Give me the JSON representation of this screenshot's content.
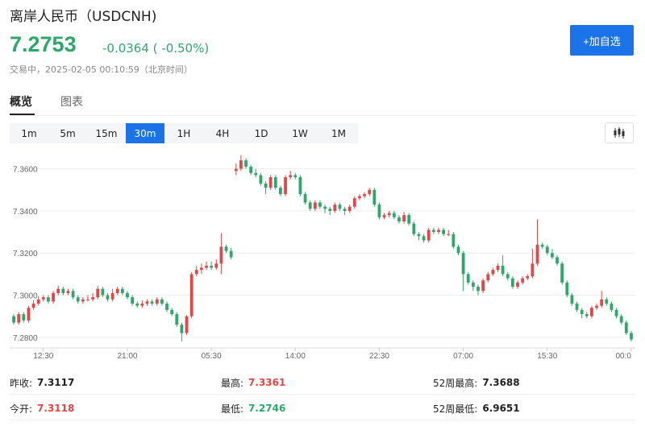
{
  "header": {
    "title": "离岸人民币（USDCNH)",
    "price": "7.2753",
    "change": "-0.0364 ( -0.50%)",
    "status": "交易中，2025-02-05 00:10:59（北京时间）",
    "add_button": "+加自选"
  },
  "tabs": [
    {
      "label": "概览",
      "active": true
    },
    {
      "label": "图表",
      "active": false
    }
  ],
  "intervals": [
    {
      "label": "1m",
      "active": false
    },
    {
      "label": "5m",
      "active": false
    },
    {
      "label": "15m",
      "active": false
    },
    {
      "label": "30m",
      "active": true
    },
    {
      "label": "1H",
      "active": false
    },
    {
      "label": "4H",
      "active": false
    },
    {
      "label": "1D",
      "active": false
    },
    {
      "label": "1W",
      "active": false
    },
    {
      "label": "1M",
      "active": false
    }
  ],
  "chart_type_icon": "candlestick-icon",
  "colors": {
    "up": "#e64545",
    "down": "#2ca86a",
    "accent": "#1a73e8"
  },
  "chart_data": {
    "type": "candlestick",
    "y_ticks": [
      "7.3600",
      "7.3400",
      "7.3200",
      "7.3000",
      "7.2800"
    ],
    "ylim": [
      7.2765,
      7.3675
    ],
    "x_ticks": [
      "12:30",
      "21:00",
      "05:30",
      "14:00",
      "22:30",
      "07:00",
      "15:30",
      "00:0"
    ],
    "x_tick_index": [
      6,
      23,
      40,
      57,
      74,
      91,
      108,
      125
    ],
    "candles": [
      [
        7.29,
        7.287,
        7.291,
        7.286
      ],
      [
        7.287,
        7.291,
        7.292,
        7.286
      ],
      [
        7.291,
        7.288,
        7.292,
        7.287
      ],
      [
        7.288,
        7.294,
        7.295,
        7.287
      ],
      [
        7.294,
        7.296,
        7.2975,
        7.293
      ],
      [
        7.296,
        7.298,
        7.2995,
        7.295
      ],
      [
        7.298,
        7.299,
        7.3,
        7.297
      ],
      [
        7.299,
        7.297,
        7.3,
        7.296
      ],
      [
        7.297,
        7.301,
        7.302,
        7.296
      ],
      [
        7.301,
        7.303,
        7.3045,
        7.3
      ],
      [
        7.303,
        7.301,
        7.304,
        7.3
      ],
      [
        7.301,
        7.302,
        7.303,
        7.3
      ],
      [
        7.302,
        7.299,
        7.303,
        7.298
      ],
      [
        7.299,
        7.297,
        7.3,
        7.296
      ],
      [
        7.297,
        7.298,
        7.299,
        7.296
      ],
      [
        7.298,
        7.298,
        7.3,
        7.297
      ],
      [
        7.298,
        7.299,
        7.301,
        7.297
      ],
      [
        7.299,
        7.303,
        7.3045,
        7.298
      ],
      [
        7.303,
        7.3,
        7.304,
        7.299
      ],
      [
        7.3,
        7.298,
        7.301,
        7.297
      ],
      [
        7.298,
        7.301,
        7.303,
        7.297
      ],
      [
        7.301,
        7.303,
        7.304,
        7.3
      ],
      [
        7.303,
        7.301,
        7.304,
        7.3
      ],
      [
        7.301,
        7.299,
        7.302,
        7.298
      ],
      [
        7.299,
        7.296,
        7.3,
        7.295
      ],
      [
        7.296,
        7.295,
        7.297,
        7.294
      ],
      [
        7.295,
        7.296,
        7.2975,
        7.294
      ],
      [
        7.296,
        7.297,
        7.298,
        7.295
      ],
      [
        7.297,
        7.296,
        7.298,
        7.295
      ],
      [
        7.296,
        7.298,
        7.299,
        7.295
      ],
      [
        7.298,
        7.296,
        7.299,
        7.295
      ],
      [
        7.296,
        7.293,
        7.297,
        7.292
      ],
      [
        7.293,
        7.291,
        7.294,
        7.29
      ],
      [
        7.291,
        7.286,
        7.292,
        7.285
      ],
      [
        7.286,
        7.282,
        7.287,
        7.278
      ],
      [
        7.282,
        7.29,
        7.2905,
        7.281
      ],
      [
        7.29,
        7.31,
        7.311,
        7.289
      ],
      [
        7.31,
        7.312,
        7.314,
        7.309
      ],
      [
        7.312,
        7.313,
        7.315,
        7.31
      ],
      [
        7.313,
        7.314,
        7.316,
        7.312
      ],
      [
        7.314,
        7.313,
        7.316,
        7.312
      ],
      [
        7.313,
        7.315,
        7.317,
        7.312
      ],
      [
        7.315,
        7.323,
        7.3295,
        7.31
      ],
      [
        7.323,
        7.321,
        7.324,
        7.32
      ],
      [
        7.321,
        7.318,
        7.3225,
        7.317
      ],
      [
        7.359,
        7.36,
        7.3625,
        7.357
      ],
      [
        7.36,
        7.364,
        7.3665,
        7.359
      ],
      [
        7.364,
        7.361,
        7.365,
        7.36
      ],
      [
        7.361,
        7.358,
        7.362,
        7.357
      ],
      [
        7.358,
        7.357,
        7.36,
        7.356
      ],
      [
        7.357,
        7.353,
        7.358,
        7.352
      ],
      [
        7.353,
        7.351,
        7.354,
        7.348
      ],
      [
        7.351,
        7.356,
        7.357,
        7.35
      ],
      [
        7.356,
        7.351,
        7.357,
        7.35
      ],
      [
        7.351,
        7.348,
        7.352,
        7.347
      ],
      [
        7.348,
        7.356,
        7.357,
        7.347
      ],
      [
        7.356,
        7.357,
        7.359,
        7.355
      ],
      [
        7.357,
        7.356,
        7.358,
        7.355
      ],
      [
        7.356,
        7.348,
        7.357,
        7.347
      ],
      [
        7.348,
        7.344,
        7.349,
        7.343
      ],
      [
        7.344,
        7.341,
        7.345,
        7.34
      ],
      [
        7.341,
        7.344,
        7.345,
        7.34
      ],
      [
        7.344,
        7.342,
        7.345,
        7.341
      ],
      [
        7.342,
        7.341,
        7.343,
        7.339
      ],
      [
        7.341,
        7.34,
        7.342,
        7.338
      ],
      [
        7.34,
        7.343,
        7.344,
        7.339
      ],
      [
        7.343,
        7.341,
        7.344,
        7.34
      ],
      [
        7.341,
        7.34,
        7.342,
        7.338
      ],
      [
        7.34,
        7.342,
        7.343,
        7.339
      ],
      [
        7.342,
        7.346,
        7.347,
        7.341
      ],
      [
        7.346,
        7.347,
        7.348,
        7.345
      ],
      [
        7.347,
        7.348,
        7.349,
        7.346
      ],
      [
        7.348,
        7.35,
        7.351,
        7.347
      ],
      [
        7.35,
        7.343,
        7.351,
        7.342
      ],
      [
        7.343,
        7.337,
        7.344,
        7.336
      ],
      [
        7.337,
        7.338,
        7.339,
        7.336
      ],
      [
        7.338,
        7.339,
        7.34,
        7.337
      ],
      [
        7.339,
        7.337,
        7.34,
        7.336
      ],
      [
        7.337,
        7.335,
        7.338,
        7.334
      ],
      [
        7.335,
        7.338,
        7.3395,
        7.334
      ],
      [
        7.338,
        7.334,
        7.339,
        7.333
      ],
      [
        7.334,
        7.329,
        7.335,
        7.328
      ],
      [
        7.329,
        7.328,
        7.33,
        7.326
      ],
      [
        7.328,
        7.326,
        7.329,
        7.325
      ],
      [
        7.326,
        7.331,
        7.332,
        7.325
      ],
      [
        7.331,
        7.33,
        7.332,
        7.329
      ],
      [
        7.33,
        7.331,
        7.332,
        7.329
      ],
      [
        7.331,
        7.329,
        7.332,
        7.328
      ],
      [
        7.329,
        7.329,
        7.331,
        7.328
      ],
      [
        7.329,
        7.323,
        7.33,
        7.322
      ],
      [
        7.323,
        7.32,
        7.324,
        7.319
      ],
      [
        7.32,
        7.31,
        7.321,
        7.302
      ],
      [
        7.31,
        7.306,
        7.311,
        7.305
      ],
      [
        7.306,
        7.304,
        7.307,
        7.302
      ],
      [
        7.304,
        7.302,
        7.305,
        7.3
      ],
      [
        7.302,
        7.307,
        7.308,
        7.301
      ],
      [
        7.307,
        7.31,
        7.311,
        7.306
      ],
      [
        7.31,
        7.312,
        7.313,
        7.309
      ],
      [
        7.312,
        7.314,
        7.315,
        7.311
      ],
      [
        7.314,
        7.31,
        7.319,
        7.309
      ],
      [
        7.31,
        7.308,
        7.311,
        7.307
      ],
      [
        7.308,
        7.304,
        7.309,
        7.303
      ],
      [
        7.304,
        7.306,
        7.307,
        7.303
      ],
      [
        7.306,
        7.308,
        7.309,
        7.305
      ],
      [
        7.308,
        7.309,
        7.31,
        7.307
      ],
      [
        7.309,
        7.315,
        7.322,
        7.308
      ],
      [
        7.315,
        7.324,
        7.336,
        7.314
      ],
      [
        7.324,
        7.323,
        7.325,
        7.322
      ],
      [
        7.323,
        7.32,
        7.324,
        7.319
      ],
      [
        7.32,
        7.318,
        7.322,
        7.317
      ],
      [
        7.318,
        7.315,
        7.319,
        7.314
      ],
      [
        7.315,
        7.306,
        7.316,
        7.305
      ],
      [
        7.306,
        7.3,
        7.307,
        7.299
      ],
      [
        7.3,
        7.296,
        7.301,
        7.295
      ],
      [
        7.296,
        7.293,
        7.297,
        7.292
      ],
      [
        7.293,
        7.291,
        7.294,
        7.289
      ],
      [
        7.291,
        7.29,
        7.292,
        7.289
      ],
      [
        7.29,
        7.294,
        7.295,
        7.289
      ],
      [
        7.294,
        7.295,
        7.296,
        7.293
      ],
      [
        7.295,
        7.298,
        7.302,
        7.294
      ],
      [
        7.298,
        7.296,
        7.299,
        7.295
      ],
      [
        7.296,
        7.293,
        7.297,
        7.292
      ],
      [
        7.293,
        7.29,
        7.294,
        7.289
      ],
      [
        7.29,
        7.287,
        7.291,
        7.286
      ],
      [
        7.287,
        7.282,
        7.288,
        7.281
      ],
      [
        7.282,
        7.279,
        7.283,
        7.278
      ]
    ]
  },
  "stats": [
    [
      {
        "label": "昨收:",
        "value": "7.3117",
        "tone": "black"
      },
      {
        "label": "最高:",
        "value": "7.3361",
        "tone": "red"
      },
      {
        "label": "52周最高:",
        "value": "7.3688",
        "tone": "black"
      }
    ],
    [
      {
        "label": "今开:",
        "value": "7.3118",
        "tone": "red"
      },
      {
        "label": "最低:",
        "value": "7.2746",
        "tone": "green"
      },
      {
        "label": "52周最低:",
        "value": "6.9651",
        "tone": "black"
      }
    ]
  ]
}
